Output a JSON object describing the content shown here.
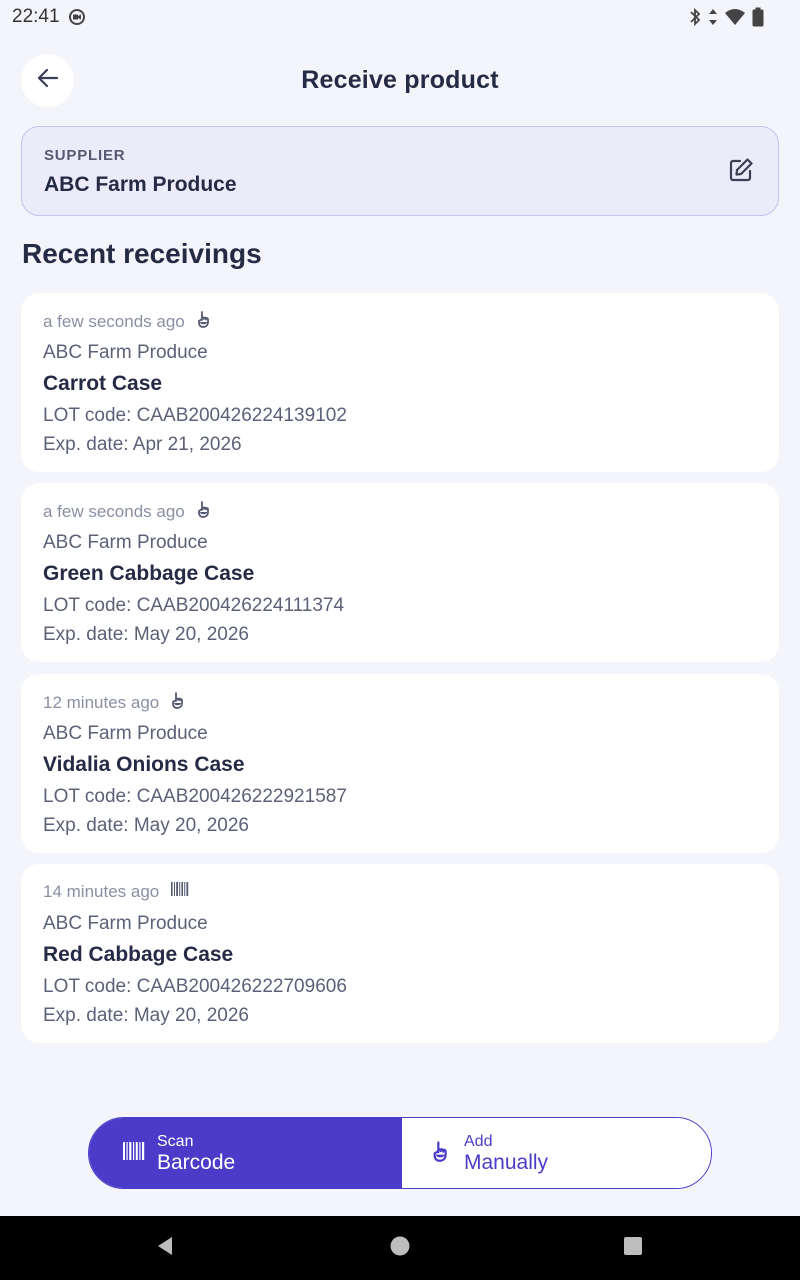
{
  "status_bar": {
    "time": "22:41"
  },
  "header": {
    "title": "Receive product"
  },
  "supplier": {
    "label": "SUPPLIER",
    "name": "ABC Farm Produce"
  },
  "recent": {
    "title": "Recent receivings",
    "items": [
      {
        "time": "a few seconds ago",
        "method_icon": "hand-pointer-icon",
        "supplier": "ABC Farm Produce",
        "product": "Carrot Case",
        "lot": "LOT code: CAAB200426224139102",
        "exp": "Exp. date: Apr 21, 2026"
      },
      {
        "time": "a few seconds ago",
        "method_icon": "hand-pointer-icon",
        "supplier": "ABC Farm Produce",
        "product": "Green Cabbage Case",
        "lot": "LOT code: CAAB200426224111374",
        "exp": "Exp. date: May 20, 2026"
      },
      {
        "time": "12 minutes ago",
        "method_icon": "hand-pointer-icon",
        "supplier": "ABC Farm Produce",
        "product": "Vidalia Onions Case",
        "lot": "LOT code: CAAB200426222921587",
        "exp": "Exp. date: May 20, 2026"
      },
      {
        "time": "14 minutes ago",
        "method_icon": "barcode-icon",
        "supplier": "ABC Farm Produce",
        "product": "Red Cabbage Case",
        "lot": "LOT code: CAAB200426222709606",
        "exp": "Exp. date: May 20, 2026"
      }
    ]
  },
  "actions": {
    "scan": {
      "small": "Scan",
      "big": "Barcode"
    },
    "manual": {
      "small": "Add",
      "big": "Manually"
    }
  },
  "colors": {
    "accent": "#4A3CC8",
    "supplier_bg": "#ECEBFA",
    "text_dark": "#262B45",
    "text_muted": "#8A8FA3"
  }
}
